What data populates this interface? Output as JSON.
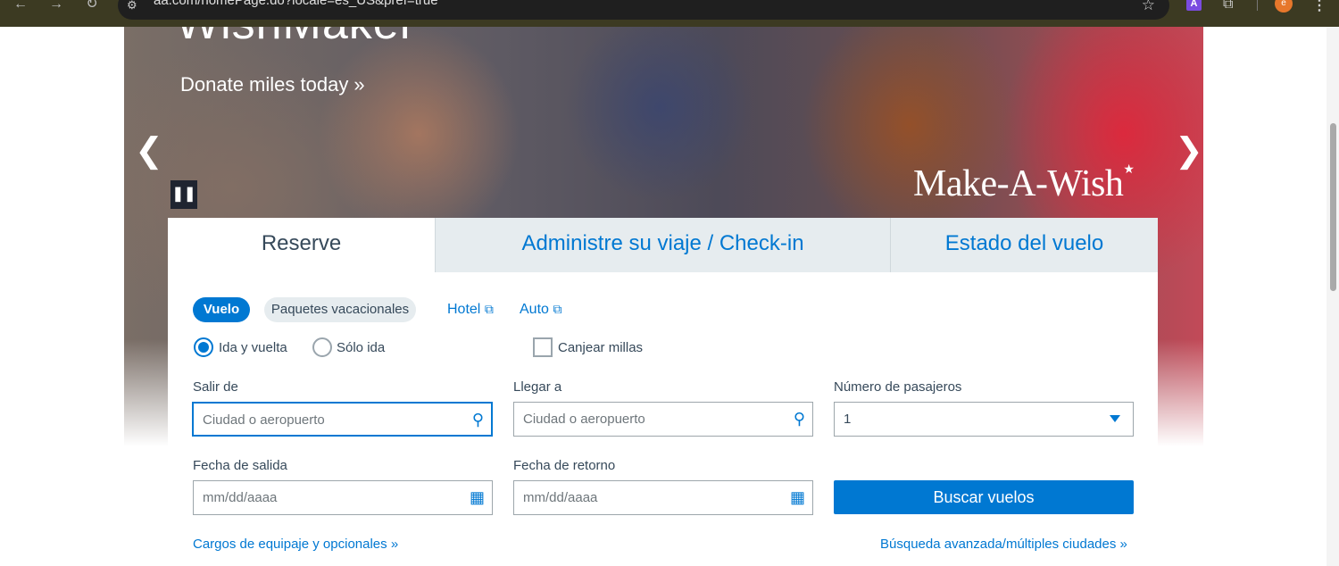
{
  "browser": {
    "url": "aa.com/homePage.do?locale=es_US&pref=true",
    "ext_letter": "A",
    "avatar_letter": "e"
  },
  "hero": {
    "title": "WishMaker",
    "cta": "Donate miles today »",
    "partner_logo": "Make-A-Wish"
  },
  "tabs": [
    {
      "label": "Reserve"
    },
    {
      "label": "Administre su viaje / Check-in"
    },
    {
      "label": "Estado del vuelo"
    }
  ],
  "booking": {
    "type_pills": {
      "flight": "Vuelo",
      "vacation": "Paquetes vacacionales"
    },
    "ext_links": {
      "hotel": "Hotel",
      "car": "Auto"
    },
    "trip": {
      "roundtrip": "Ida y vuelta",
      "oneway": "Sólo ida",
      "selected": "roundtrip"
    },
    "redeem_miles": {
      "label": "Canjear millas",
      "checked": false
    },
    "from": {
      "label": "Salir de",
      "placeholder": "Ciudad o aeropuerto",
      "value": ""
    },
    "to": {
      "label": "Llegar a",
      "placeholder": "Ciudad o aeropuerto",
      "value": ""
    },
    "passengers": {
      "label": "Número de pasajeros",
      "value": "1"
    },
    "depart": {
      "label": "Fecha de salida",
      "placeholder": "mm/dd/aaaa"
    },
    "return": {
      "label": "Fecha de retorno",
      "placeholder": "mm/dd/aaaa"
    },
    "search_button": "Buscar vuelos",
    "bag_link": "Cargos de equipaje y opcionales »",
    "advanced_link": "Búsqueda avanzada/múltiples ciudades »"
  },
  "colors": {
    "accent": "#0078d2",
    "text": "#36495a",
    "tab_inactive_bg": "#e6ecef"
  }
}
